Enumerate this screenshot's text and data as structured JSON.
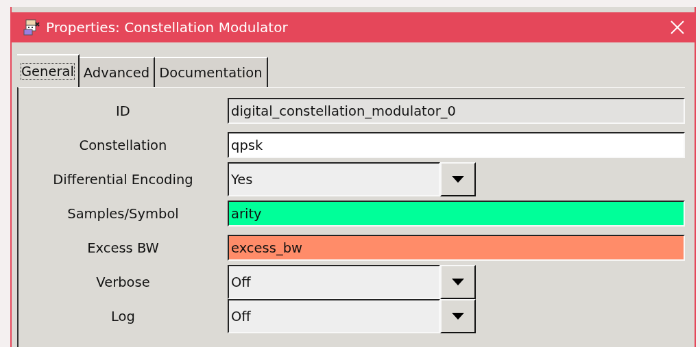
{
  "window": {
    "title": "Properties: Constellation Modulator"
  },
  "tabs": [
    {
      "label": "General",
      "selected": true
    },
    {
      "label": "Advanced",
      "selected": false
    },
    {
      "label": "Documentation",
      "selected": false
    }
  ],
  "params": [
    {
      "label": "ID",
      "kind": "readonly",
      "value": "digital_constellation_modulator_0"
    },
    {
      "label": "Constellation",
      "kind": "entry",
      "value": "qpsk",
      "color": "#ffffff"
    },
    {
      "label": "Differential Encoding",
      "kind": "dropdown",
      "value": "Yes"
    },
    {
      "label": "Samples/Symbol",
      "kind": "entry",
      "value": "arity",
      "color": "#00ff99"
    },
    {
      "label": "Excess BW",
      "kind": "entry",
      "value": "excess_bw",
      "color": "#ff8c69"
    },
    {
      "label": "Verbose",
      "kind": "dropdown",
      "value": "Off"
    },
    {
      "label": "Log",
      "kind": "dropdown",
      "value": "Off"
    }
  ]
}
